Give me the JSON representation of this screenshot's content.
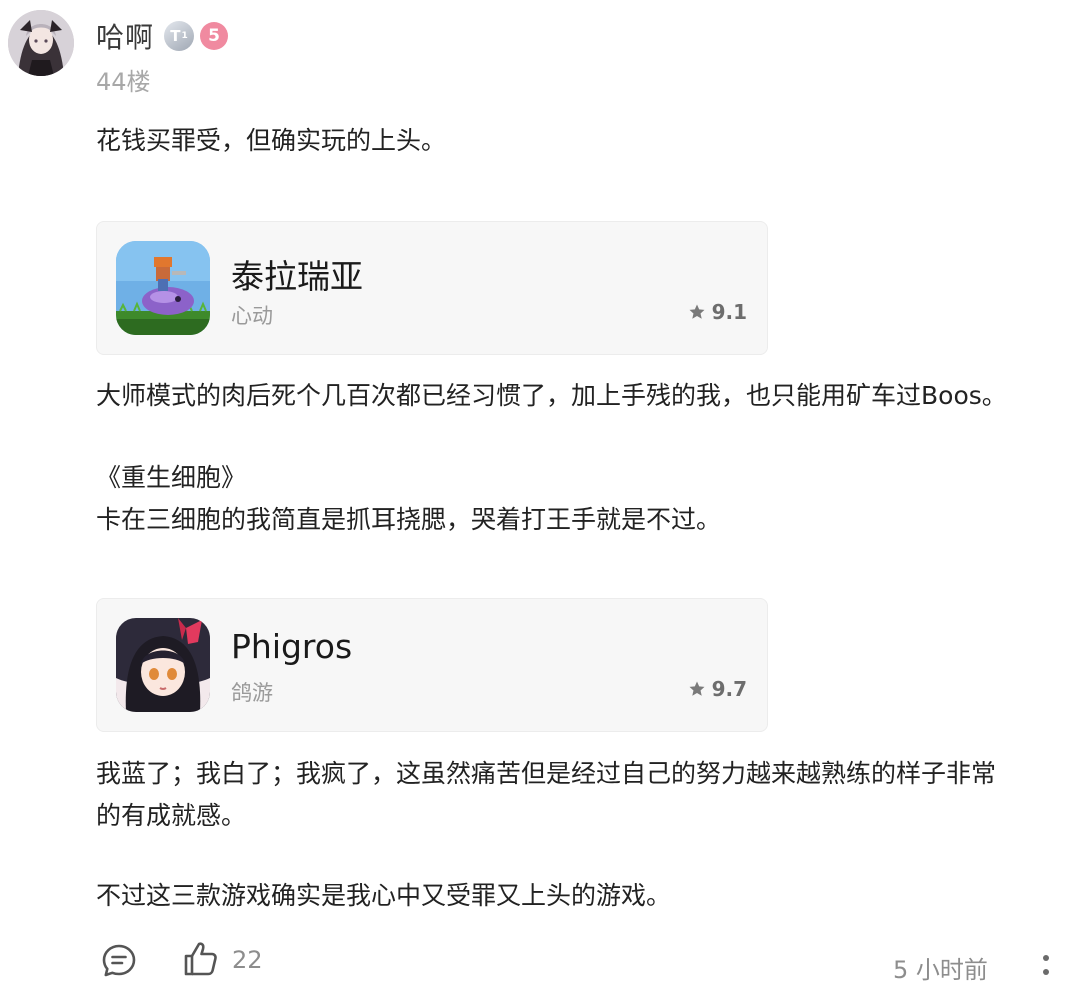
{
  "post": {
    "username": "哈啊",
    "level_badge": "T",
    "level_sub": "1",
    "medal_badge": "5",
    "floor": "44楼"
  },
  "body": {
    "p1": "花钱买罪受，但确实玩的上头。",
    "p2": "大师模式的肉后死个几百次都已经习惯了，加上手残的我，也只能用矿车过Boos。",
    "p3": "《重生细胞》",
    "p4": "卡在三细胞的我简直是抓耳挠腮，哭着打王手就是不过。",
    "p5_line1": "我蓝了；我白了；我疯了，这虽然痛苦但是经过自己的努力越来越熟练的样子非常",
    "p5_line2": "的有成就感。",
    "p6": "不过这三款游戏确实是我心中又受罪又上头的游戏。"
  },
  "cards": [
    {
      "title": "泰拉瑞亚",
      "developer": "心动",
      "rating": "9.1",
      "icon": "terraria-game-icon"
    },
    {
      "title": "Phigros",
      "developer": "鸽游",
      "rating": "9.7",
      "icon": "phigros-game-icon"
    }
  ],
  "footer": {
    "like_count": "22",
    "time": "5 小时前"
  },
  "colors": {
    "rating_star": "#7a7a7a",
    "card_bg": "#f7f7f7",
    "meta_text": "#a8a8a8"
  }
}
